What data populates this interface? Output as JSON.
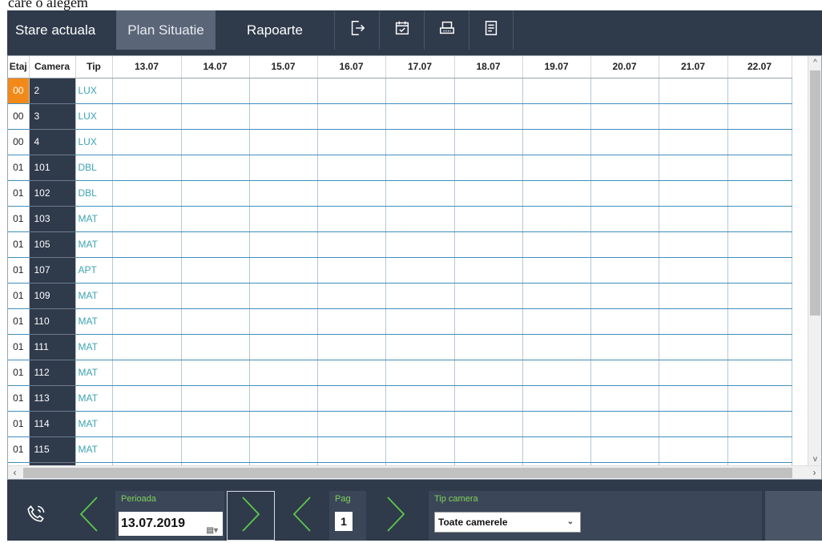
{
  "doc_text": "care o alegem",
  "tabs": [
    {
      "label": "Stare actuala"
    },
    {
      "label": "Plan Situatie"
    },
    {
      "label": "Rapoarte"
    }
  ],
  "toolbar_icons": [
    "exit-icon",
    "calendar-check-icon",
    "printer-icon",
    "report-icon"
  ],
  "grid": {
    "headers": [
      "Etaj",
      "Camera",
      "Tip",
      "13.07",
      "14.07",
      "15.07",
      "16.07",
      "17.07",
      "18.07",
      "19.07",
      "20.07",
      "21.07",
      "22.07"
    ],
    "rows": [
      {
        "etaj": "00",
        "camera": "2",
        "tip": "LUX"
      },
      {
        "etaj": "00",
        "camera": "3",
        "tip": "LUX"
      },
      {
        "etaj": "00",
        "camera": "4",
        "tip": "LUX"
      },
      {
        "etaj": "01",
        "camera": "101",
        "tip": "DBL"
      },
      {
        "etaj": "01",
        "camera": "102",
        "tip": "DBL"
      },
      {
        "etaj": "01",
        "camera": "103",
        "tip": "MAT"
      },
      {
        "etaj": "01",
        "camera": "105",
        "tip": "MAT"
      },
      {
        "etaj": "01",
        "camera": "107",
        "tip": "APT"
      },
      {
        "etaj": "01",
        "camera": "109",
        "tip": "MAT"
      },
      {
        "etaj": "01",
        "camera": "110",
        "tip": "MAT"
      },
      {
        "etaj": "01",
        "camera": "111",
        "tip": "MAT"
      },
      {
        "etaj": "01",
        "camera": "112",
        "tip": "MAT"
      },
      {
        "etaj": "01",
        "camera": "113",
        "tip": "MAT"
      },
      {
        "etaj": "01",
        "camera": "114",
        "tip": "MAT"
      },
      {
        "etaj": "01",
        "camera": "115",
        "tip": "MAT"
      }
    ],
    "selected_row_index": 0
  },
  "bottom": {
    "perioada_label": "Perioada",
    "perioada_value": "13.07.2019",
    "pag_label": "Pag",
    "pag_value": "1",
    "tip_camera_label": "Tip camera",
    "tip_camera_value": "Toate camerele"
  },
  "colors": {
    "app_bg": "#2f3a4b",
    "accent_green": "#7fd35a",
    "selected_orange": "#f28a1a",
    "tip_text": "#3aa3b3"
  }
}
